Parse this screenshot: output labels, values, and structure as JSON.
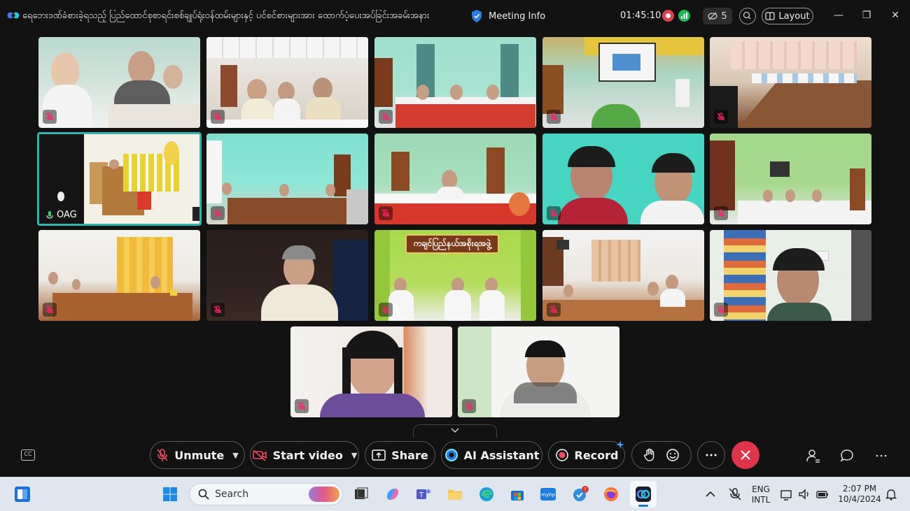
{
  "window": {
    "title": "ရေဘေးဒဏ်ခံစားခဲ့ရသည့် ပြည်ထောင်စုစာရင်းစစ်ချုပ်ရုံးဝန်ထမ်းများနှင့် ပင်စင်စားများအား ထောက်ပံ့ပေးအပ်ခြင်းအခမ်းအနား",
    "meeting_info_label": "Meeting Info",
    "timer": "01:45:10",
    "hidden_participants_count": "5",
    "layout_label": "Layout",
    "minimize": "—",
    "restore": "❐",
    "close": "✕"
  },
  "participants": [
    {
      "id": "p1",
      "muted": true
    },
    {
      "id": "p2",
      "muted": true
    },
    {
      "id": "p3",
      "muted": true
    },
    {
      "id": "p4",
      "muted": true
    },
    {
      "id": "p5",
      "muted": true
    },
    {
      "id": "p6",
      "name": "OAG",
      "active_speaker": true
    },
    {
      "id": "p7",
      "muted": true
    },
    {
      "id": "p8",
      "muted": true
    },
    {
      "id": "p9",
      "muted": true
    },
    {
      "id": "p10",
      "muted": true
    },
    {
      "id": "p11",
      "muted": true
    },
    {
      "id": "p12",
      "muted": true
    },
    {
      "id": "p13",
      "muted": true,
      "banner_text": "ကချင်ပြည်နယ်အစိုးရအဖွဲ့"
    },
    {
      "id": "p14",
      "muted": true
    },
    {
      "id": "p15",
      "muted": true
    },
    {
      "id": "p16",
      "muted": true
    },
    {
      "id": "p17",
      "muted": true
    }
  ],
  "controls": {
    "unmute": "Unmute",
    "start_video": "Start video",
    "share": "Share",
    "ai_assistant": "AI Assistant",
    "record": "Record"
  },
  "taskbar": {
    "search_placeholder": "Search",
    "language_top": "ENG",
    "language_bottom": "INTL",
    "time": "2:07 PM",
    "date": "10/4/2024"
  },
  "colors": {
    "active_border": "#2fb5ad",
    "end_call": "#e0344a",
    "record_dot": "#e0414e",
    "signal": "#1db954",
    "background": "#121212"
  }
}
